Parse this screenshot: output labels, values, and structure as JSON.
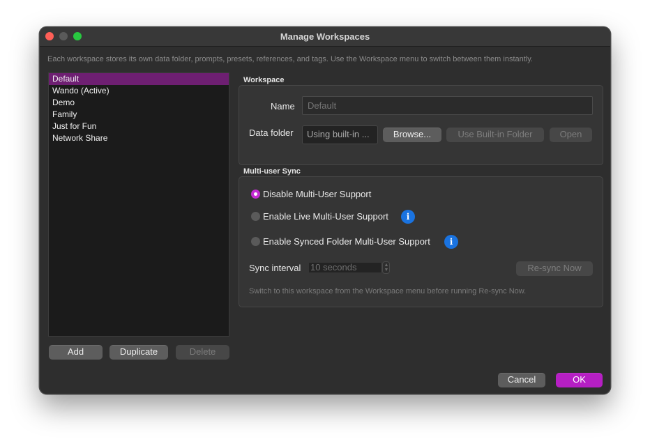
{
  "window": {
    "title": "Manage Workspaces",
    "description": "Each workspace stores its own data folder, prompts, presets, references, and tags. Use the Workspace menu to switch between them instantly."
  },
  "workspaces": {
    "items": [
      "Default",
      "Wando (Active)",
      "Demo",
      "Family",
      "Just for Fun",
      "Network Share"
    ],
    "selected": "Default",
    "add_label": "Add",
    "duplicate_label": "Duplicate",
    "delete_label": "Delete"
  },
  "workspace_section": {
    "heading": "Workspace",
    "name_label": "Name",
    "name_placeholder": "Default",
    "data_folder_label": "Data folder",
    "data_folder_value": "Using built-in ...",
    "browse_label": "Browse...",
    "use_builtin_label": "Use Built-in Folder",
    "open_label": "Open"
  },
  "sync_section": {
    "heading": "Multi-user Sync",
    "options": [
      {
        "label": "Disable Multi-User Support",
        "selected": true
      },
      {
        "label": "Enable Live Multi-User Support",
        "selected": false
      },
      {
        "label": "Enable Synced Folder Multi-User Support",
        "selected": false
      }
    ],
    "info_glyph": "i",
    "sync_interval_label": "Sync interval",
    "sync_interval_value": "10 seconds",
    "resync_label": "Re-sync Now",
    "hint": "Switch to this workspace from the Workspace menu before running Re-sync Now."
  },
  "footer": {
    "cancel_label": "Cancel",
    "ok_label": "OK"
  },
  "colors": {
    "accent": "#b61fc4",
    "selection": "#6e1f72",
    "info": "#1a73e0"
  }
}
